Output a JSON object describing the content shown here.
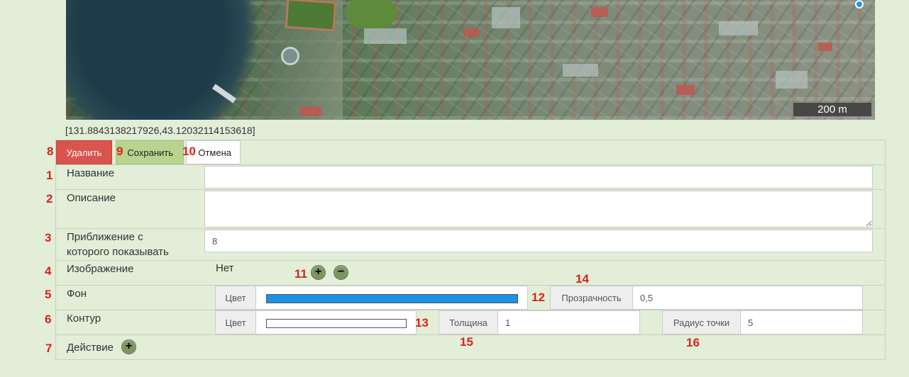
{
  "map": {
    "scale_label": "200 m"
  },
  "coordinates": "[131.8843138217926,43.12032114153618]",
  "toolbar": {
    "delete_label": "Удалить",
    "save_label": "Сохранить",
    "cancel_label": "Отмена"
  },
  "form": {
    "name_label": "Название",
    "name_value": "",
    "description_label": "Описание",
    "description_value": "",
    "zoom_label_line1": "Приближение с",
    "zoom_label_line2": "которого показывать",
    "zoom_value": "8",
    "image_label": "Изображение",
    "image_value": "Нет",
    "background_label": "Фон",
    "background_color_addon": "Цвет",
    "background_color": "#1e90e6",
    "opacity_addon": "Прозрачность",
    "opacity_value": "0,5",
    "outline_label": "Контур",
    "outline_color_addon": "Цвет",
    "outline_color": "#ffffff",
    "thickness_addon": "Толщина",
    "thickness_value": "1",
    "point_radius_addon": "Радиус точки",
    "point_radius_value": "5",
    "action_label": "Действие"
  },
  "annotations": {
    "n1": "1",
    "n2": "2",
    "n3": "3",
    "n4": "4",
    "n5": "5",
    "n6": "6",
    "n7": "7",
    "n8": "8",
    "n9": "9",
    "n10": "10",
    "n11": "11",
    "n12": "12",
    "n13": "13",
    "n14": "14",
    "n15": "15",
    "n16": "16"
  },
  "icons": {
    "add": "plus-icon",
    "remove": "minus-icon"
  }
}
